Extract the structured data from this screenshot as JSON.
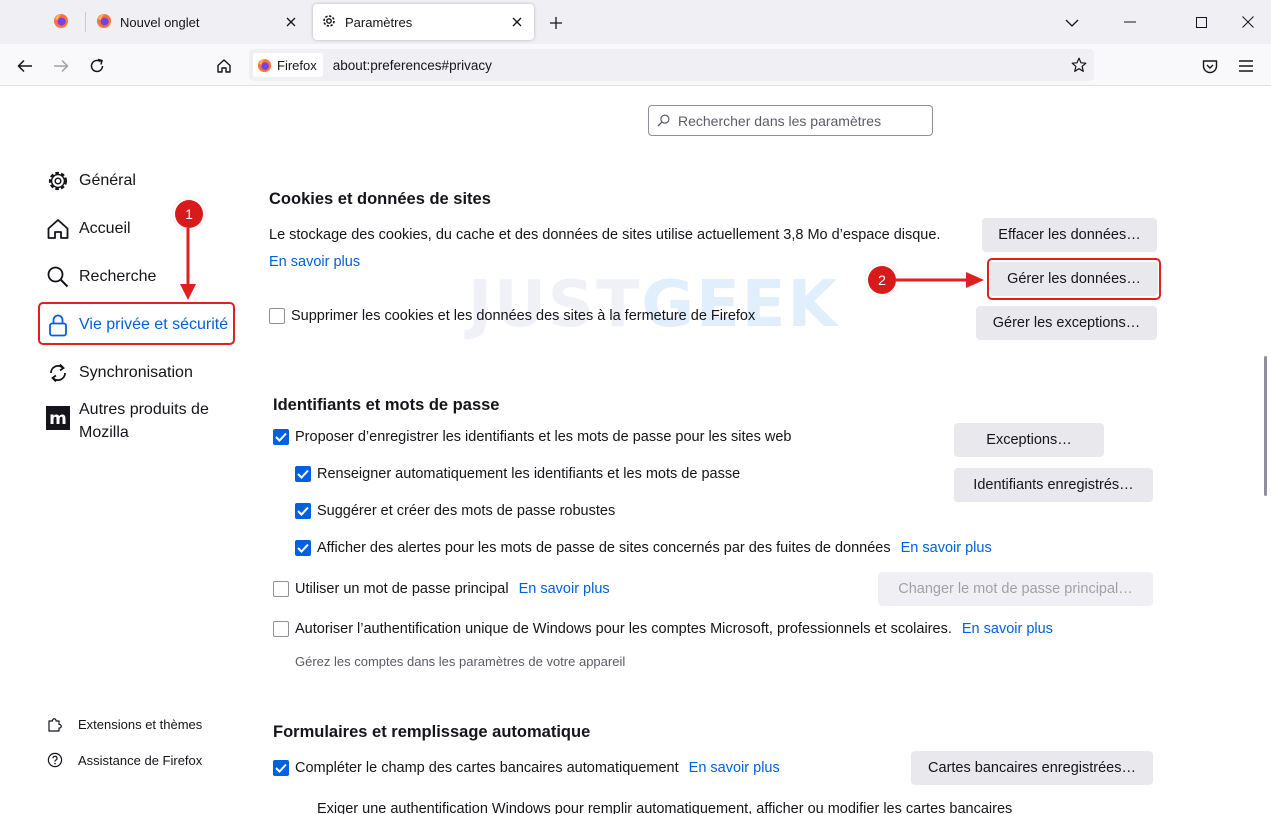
{
  "browser": {
    "tabs": [
      {
        "label": "",
        "icon": "firefox-logo-icon",
        "pinned": true
      },
      {
        "label": "Nouvel onglet",
        "icon": "firefox-logo-icon"
      },
      {
        "label": "Paramètres",
        "icon": "gear-icon",
        "active": true
      }
    ],
    "identity_label": "Firefox",
    "url": "about:preferences#privacy"
  },
  "search": {
    "placeholder": "Rechercher dans les paramètres"
  },
  "sidebar": {
    "items": [
      {
        "label": "Général",
        "icon": "gear-icon"
      },
      {
        "label": "Accueil",
        "icon": "home-icon"
      },
      {
        "label": "Recherche",
        "icon": "search-icon"
      },
      {
        "label": "Vie privée et sécurité",
        "icon": "lock-icon",
        "active": true
      },
      {
        "label": "Synchronisation",
        "icon": "sync-icon"
      },
      {
        "label": "Autres produits de Mozilla",
        "icon": "mozilla-logo-icon"
      }
    ],
    "footer": [
      {
        "label": "Extensions et thèmes",
        "icon": "puzzle-icon"
      },
      {
        "label": "Assistance de Firefox",
        "icon": "help-icon"
      }
    ]
  },
  "cookies": {
    "title": "Cookies et données de sites",
    "description": "Le stockage des cookies, du cache et des données de sites utilise actuellement 3,8 Mo d’espace disque.",
    "learn_more": "En savoir plus",
    "delete_on_close": {
      "label": "Supprimer les cookies et les données des sites à la fermeture de Firefox",
      "checked": false
    },
    "clear_button": "Effacer les données…",
    "manage_button": "Gérer les données…",
    "exceptions_button": "Gérer les exceptions…"
  },
  "logins": {
    "title": "Identifiants et mots de passe",
    "offer_save": {
      "label": "Proposer d’enregistrer les identifiants et les mots de passe pour les sites web",
      "checked": true
    },
    "autofill": {
      "label": "Renseigner automatiquement les identifiants et les mots de passe",
      "checked": true
    },
    "suggest": {
      "label": "Suggérer et créer des mots de passe robustes",
      "checked": true
    },
    "alerts": {
      "label": "Afficher des alertes pour les mots de passe de sites concernés par des fuites de données",
      "checked": true,
      "link": "En savoir plus"
    },
    "primary_password": {
      "label": "Utiliser un mot de passe principal",
      "checked": false,
      "link": "En savoir plus"
    },
    "windows_sso": {
      "label": "Autoriser l’authentification unique de Windows pour les comptes Microsoft, professionnels et scolaires.",
      "checked": false,
      "link": "En savoir plus"
    },
    "windows_sso_hint": "Gérez les comptes dans les paramètres de votre appareil",
    "exceptions_button": "Exceptions…",
    "saved_logins_button": "Identifiants enregistrés…",
    "change_primary_button": "Changer le mot de passe principal…"
  },
  "forms": {
    "title": "Formulaires et remplissage automatique",
    "autofill_cards": {
      "label": "Compléter le champ des cartes bancaires automatiquement",
      "checked": true,
      "link": "En savoir plus"
    },
    "cards_button": "Cartes bancaires enregistrées…",
    "require_auth_text": "Exiger une authentification Windows pour remplir automatiquement, afficher ou modifier les cartes bancaires"
  },
  "annotations": {
    "badge_1": "1",
    "badge_2": "2",
    "color": "#e02020"
  },
  "watermark": {
    "part1": "JUST",
    "part2": "GEEK"
  },
  "colors": {
    "accent": "#0061e0",
    "annotation": "#e02020"
  }
}
